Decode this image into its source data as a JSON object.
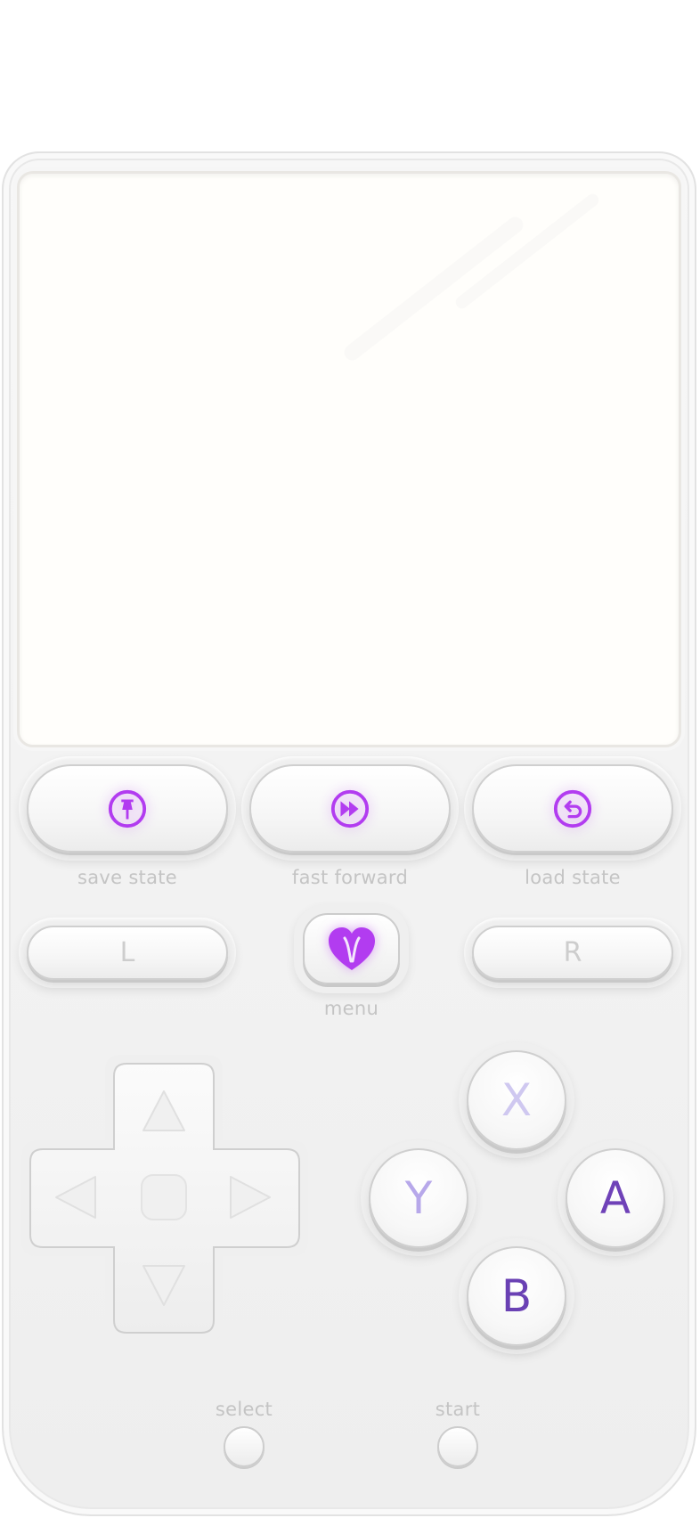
{
  "colors": {
    "accent": "#b23cf0",
    "label": "#c4c4c4",
    "face_x": "#cfc8f0",
    "face_y": "#b7a8ea",
    "face_a": "#6f42b8",
    "face_b": "#6a41b4"
  },
  "top_row": [
    {
      "label": "save state",
      "icon": "pin-icon"
    },
    {
      "label": "fast forward",
      "icon": "fast-forward-icon"
    },
    {
      "label": "load state",
      "icon": "undo-icon"
    }
  ],
  "shoulders": {
    "left": "L",
    "right": "R"
  },
  "menu": {
    "label": "menu",
    "icon": "heart-icon"
  },
  "face_buttons": {
    "x": "X",
    "y": "Y",
    "a": "A",
    "b": "B"
  },
  "bottom": {
    "select": "select",
    "start": "start"
  }
}
